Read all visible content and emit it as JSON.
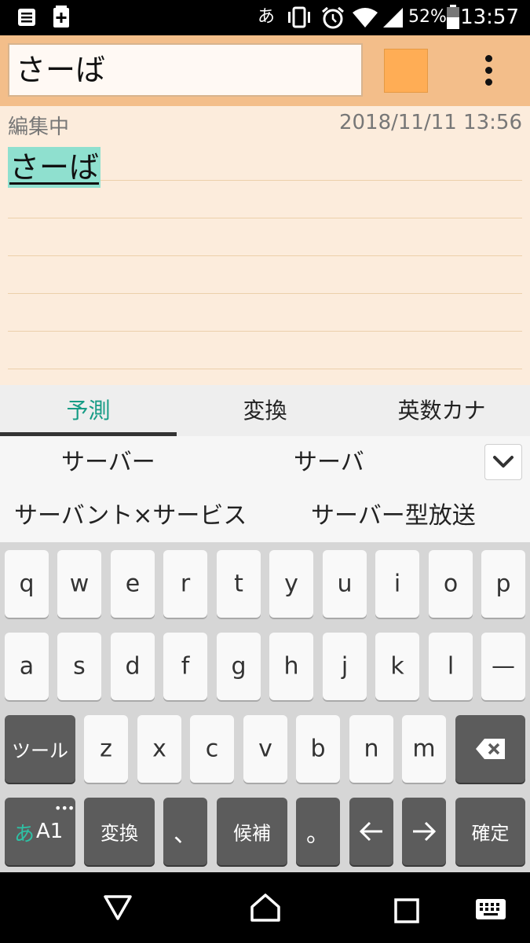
{
  "status_bar": {
    "ime_indicator": "あ",
    "battery_percent": "52%",
    "time": "13:57",
    "icons": [
      "notes-icon",
      "sim-plus-icon",
      "vibrate-icon",
      "alarm-icon",
      "wifi-icon",
      "signal-icon",
      "battery-icon"
    ]
  },
  "app_bar": {
    "title_value": "さーば",
    "color_swatch": "#ffad55",
    "menu_icon": "overflow-menu-icon"
  },
  "note": {
    "status": "編集中",
    "date": "2018/11/11 13:56",
    "text": "さーば",
    "highlight_color": "#8fe0cf"
  },
  "ime": {
    "tabs": [
      "予測",
      "変換",
      "英数カナ"
    ],
    "active_tab": "予測",
    "suggestions": [
      "サーバー",
      "サーバ",
      "サーバント×サービス",
      "サーバー型放送"
    ]
  },
  "keyboard": {
    "row1": [
      "q",
      "w",
      "e",
      "r",
      "t",
      "y",
      "u",
      "i",
      "o",
      "p"
    ],
    "row2": [
      "a",
      "s",
      "d",
      "f",
      "g",
      "h",
      "j",
      "k",
      "l",
      "—"
    ],
    "row3": [
      "z",
      "x",
      "c",
      "v",
      "b",
      "n",
      "m"
    ],
    "tool_label": "ツール",
    "mode_label_kana": "あ",
    "mode_label_alpha": "A1",
    "convert_label": "変換",
    "comma_label": "、",
    "candidate_label": "候補",
    "period_label": "。",
    "confirm_label": "確定"
  },
  "nav_bar": {
    "icons": [
      "back-icon",
      "home-icon",
      "recents-icon",
      "keyboard-icon"
    ]
  }
}
